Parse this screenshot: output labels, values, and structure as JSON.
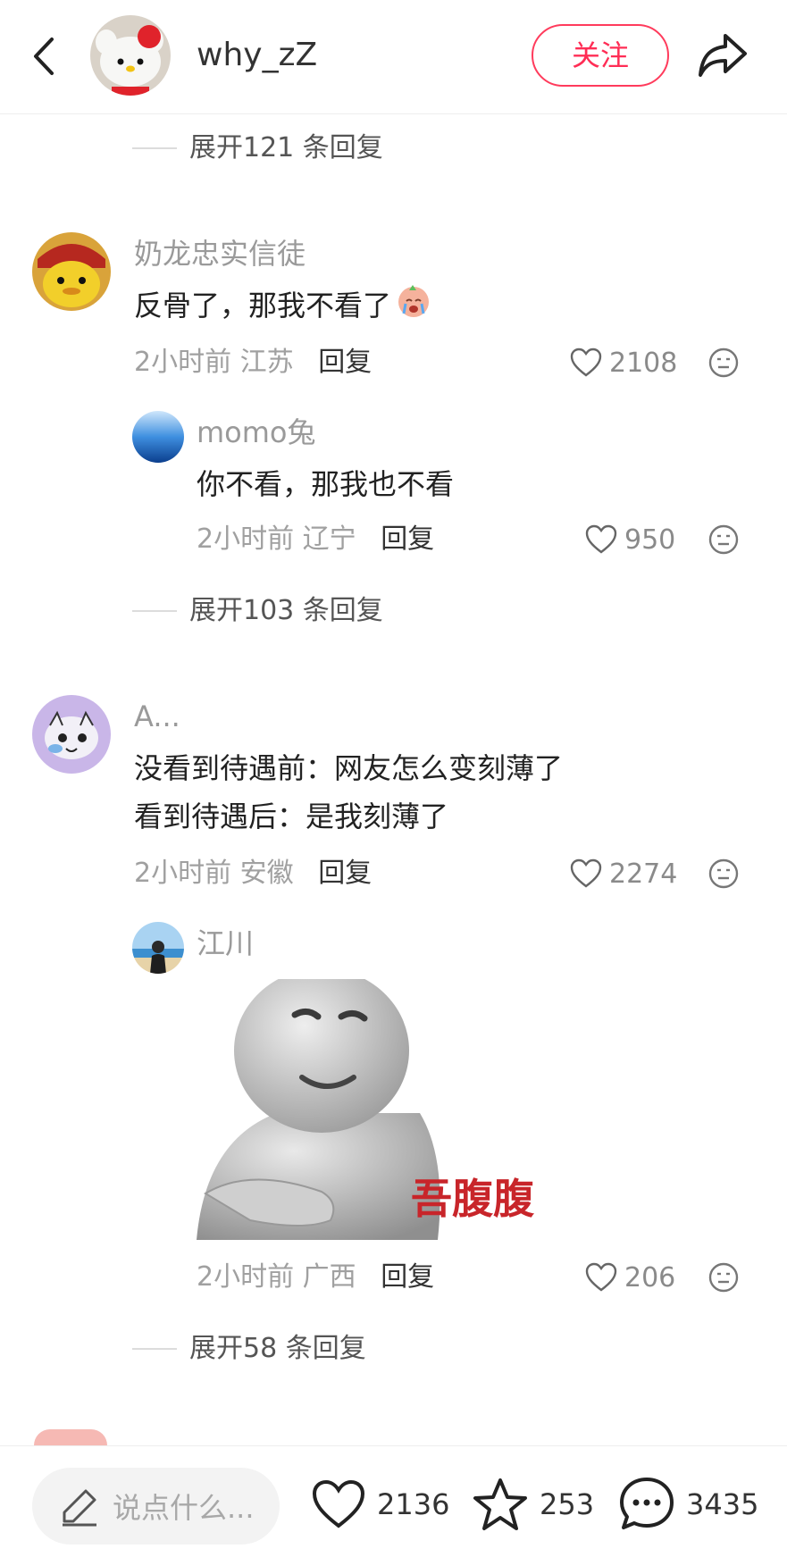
{
  "header": {
    "username": "why_zZ",
    "follow_label": "关注"
  },
  "expand_top": {
    "label": "展开121 条回复"
  },
  "comments": [
    {
      "username": "奶龙忠实信徒",
      "text": "反骨了，那我不看了",
      "time": "2小时前",
      "location": "江苏",
      "reply_label": "回复",
      "likes": "2108",
      "reply": {
        "username": "momo兔",
        "text": "你不看，那我也不看",
        "time": "2小时前",
        "location": "辽宁",
        "reply_label": "回复",
        "likes": "950"
      },
      "expand_label": "展开103 条回复"
    },
    {
      "username": "A...",
      "text_lines": [
        "没看到待遇前：网友怎么变刻薄了",
        "看到待遇后：是我刻薄了"
      ],
      "time": "2小时前",
      "location": "安徽",
      "reply_label": "回复",
      "likes": "2274",
      "reply": {
        "username": "江川",
        "sticker_caption": "吾腹腹",
        "time": "2小时前",
        "location": "广西",
        "reply_label": "回复",
        "likes": "206"
      },
      "expand_label": "展开58 条回复"
    }
  ],
  "bottom_bar": {
    "input_placeholder": "说点什么...",
    "likes": "2136",
    "favorites": "253",
    "comments": "3435"
  },
  "colors": {
    "accent": "#ff2d55",
    "muted_text": "#9a9a9a",
    "body_text": "#222222"
  }
}
